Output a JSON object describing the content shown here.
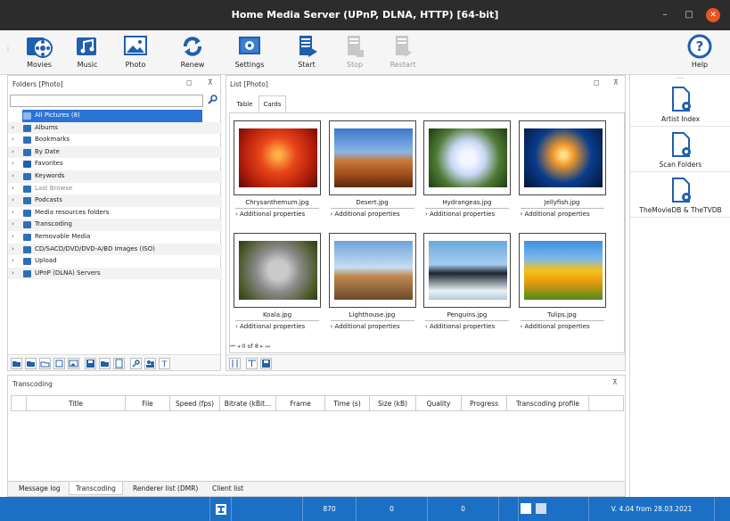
{
  "window": {
    "title": "Home Media Server (UPnP, DLNA, HTTP) [64-bit]",
    "minimize": "–",
    "maximize": "□",
    "close": "✕"
  },
  "toolbar": {
    "movies": "Movies",
    "music": "Music",
    "photo": "Photo",
    "renew": "Renew",
    "settings": "Settings",
    "start": "Start",
    "stop": "Stop",
    "restart": "Restart",
    "help": "Help"
  },
  "folders": {
    "title": "Folders [Photo]",
    "search_placeholder": "",
    "items": [
      {
        "label": "All Pictures (8)",
        "selected": true,
        "color": "#2f7bd8"
      },
      {
        "label": "Albums",
        "color": "#2f6fb8"
      },
      {
        "label": "Bookmarks",
        "color": "#2f6fb8"
      },
      {
        "label": "By Date",
        "color": "#2f6fb8"
      },
      {
        "label": "Favorites",
        "color": "#1f5fb0"
      },
      {
        "label": "Keywords",
        "color": "#2f6fb8"
      },
      {
        "label": "Last Browse",
        "color": "#2f6fb8"
      },
      {
        "label": "Podcasts",
        "color": "#2f6fb8"
      },
      {
        "label": "Media resources folders",
        "color": "#2f6fb8"
      },
      {
        "label": "Transcoding",
        "color": "#2f6fb8"
      },
      {
        "label": "Removable Media",
        "color": "#2f6fb8"
      },
      {
        "label": "CD/SACD/DVD/DVD-A/BD Images (ISO)",
        "color": "#2f6fb8"
      },
      {
        "label": "Upload",
        "color": "#2f6fb8"
      },
      {
        "label": "UPnP (DLNA) Servers",
        "color": "#2f6fb8"
      }
    ]
  },
  "list": {
    "title": "List [Photo]",
    "tabs": [
      "Table",
      "Cards"
    ],
    "pager": "0 of 8",
    "cards": [
      {
        "name": "Chrysanthemum.jpg",
        "props": "Additional properties"
      },
      {
        "name": "Desert.jpg",
        "props": "Additional properties"
      },
      {
        "name": "Hydrangeas.jpg",
        "props": "Additional properties"
      },
      {
        "name": "Jellyfish.jpg",
        "props": "Additional properties"
      },
      {
        "name": "Koala.jpg",
        "props": "Additional properties"
      },
      {
        "name": "Lighthouse.jpg",
        "props": "Additional properties"
      },
      {
        "name": "Penguins.jpg",
        "props": "Additional properties"
      },
      {
        "name": "Tulips.jpg",
        "props": "Additional properties"
      }
    ]
  },
  "side": {
    "dots": "...",
    "items": [
      "Artist Index",
      "Scan Folders",
      "TheMovieDB & TheTVDB"
    ]
  },
  "transcoding": {
    "title": "Transcoding",
    "columns": [
      "Title",
      "File",
      "Speed (fps)",
      "Bitrate (kBit...",
      "Frame",
      "Time (s)",
      "Size (kB)",
      "Quality",
      "Progress",
      "Transcoding profile"
    ]
  },
  "bottom_tabs": [
    "Message log",
    "Transcoding",
    "Renderer list (DMR)",
    "Client list"
  ],
  "status": {
    "v1": "870",
    "v2": "0",
    "v3": "0",
    "version": "V. 4.04 from 28.03.2021"
  }
}
